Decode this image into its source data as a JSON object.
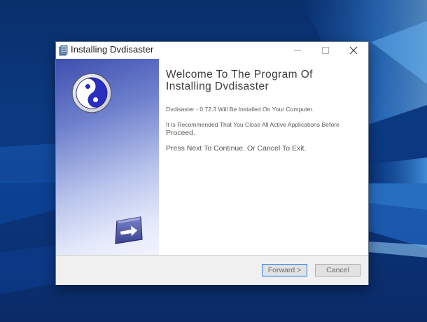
{
  "window": {
    "title": "Installing Dvdisaster",
    "app_icon": "setup-package-icon",
    "controls": {
      "minimize": "–",
      "maximize": "☐",
      "close": "✕"
    }
  },
  "sidebar": {
    "logo_icon": "yin-yang-icon",
    "bottom_icon": "arrow-right-icon"
  },
  "content": {
    "heading_line1": "Welcome To The Program Of",
    "heading_line2": "Installing Dvdisaster",
    "paragraph1": "Dvdisaster - 0.72.3 Will Be Installed On Your Computer.",
    "paragraph2_line1": "It Is Recommended That You Close All Active Applications Before",
    "paragraph2_line2": "Proceed.",
    "paragraph3": "Press Next To Continue. Or Cancel To Exit."
  },
  "footer": {
    "forward_label": "Forward >",
    "cancel_label": "Cancel"
  },
  "colors": {
    "sidebar_top": "#3e4faf",
    "sidebar_bottom": "#f2f4fd",
    "focus_border": "#3b7fd1",
    "footer_bg": "#f0f0f0"
  }
}
